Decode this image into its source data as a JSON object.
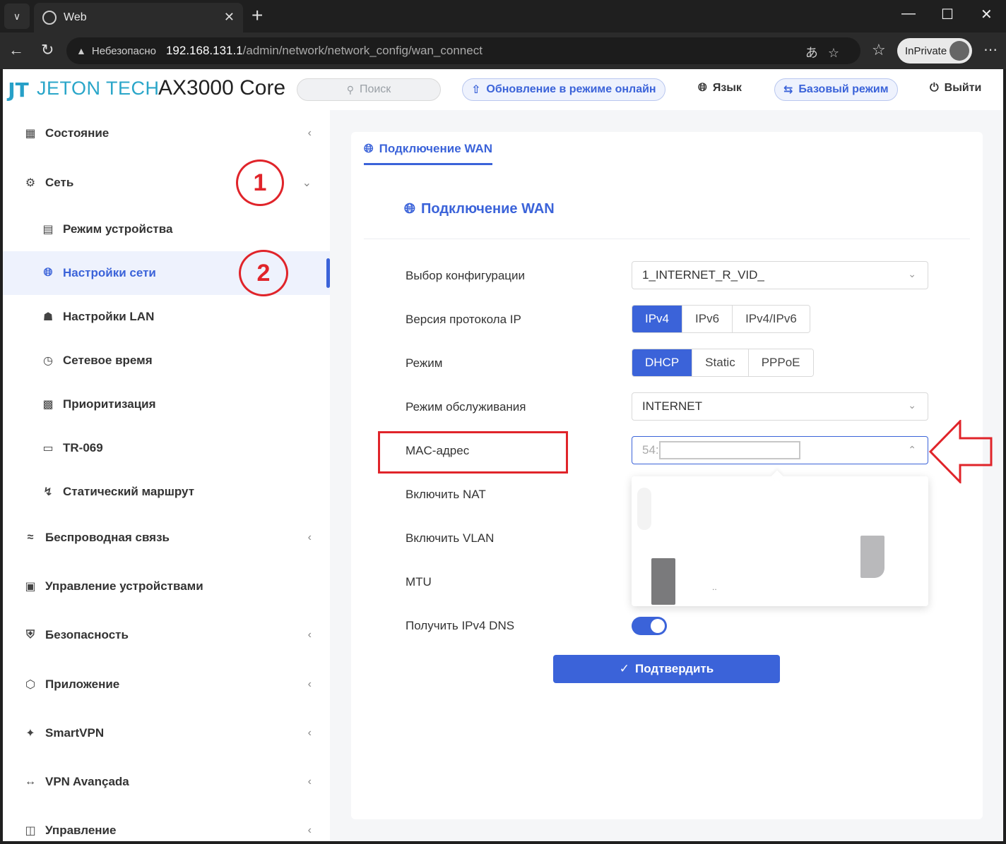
{
  "browser": {
    "tab_title": "Web",
    "security_label": "Небезопасно",
    "url_host": "192.168.131.1",
    "url_path": "/admin/network/network_config/wan_connect",
    "inprivate_label": "InPrivate"
  },
  "header": {
    "brand": "JETON TECH",
    "model": "AX3000 Core",
    "search_placeholder": "Поиск",
    "update_online": "Обновление в режиме онлайн",
    "language": "Язык",
    "basic_mode": "Базовый режим",
    "logout": "Выйти"
  },
  "sidebar": {
    "status": "Состояние",
    "network": "Сеть",
    "device_mode": "Режим устройства",
    "network_settings": "Настройки сети",
    "lan_settings": "Настройки LAN",
    "network_time": "Сетевое время",
    "prioritization": "Приоритизация",
    "tr069": "TR-069",
    "static_route": "Статический маршрут",
    "wireless": "Беспроводная связь",
    "device_management": "Управление устройствами",
    "security": "Безопасность",
    "application": "Приложение",
    "smartvpn": "SmartVPN",
    "vpn_advanced": "VPN Avançada",
    "management": "Управление"
  },
  "annotations": {
    "step1": "1",
    "step2": "2"
  },
  "main": {
    "tab_label": "Подключение WAN",
    "section_title": "Подключение WAN",
    "labels": {
      "config_select": "Выбор конфигурации",
      "ip_version": "Версия протокола IP",
      "mode": "Режим",
      "service_mode": "Режим обслуживания",
      "mac": "MAC-адрес",
      "nat": "Включить NAT",
      "vlan": "Включить VLAN",
      "mtu": "MTU",
      "ipv4_dns": "Получить IPv4 DNS"
    },
    "config_value": "1_INTERNET_R_VID_",
    "ip_versions": [
      "IPv4",
      "IPv6",
      "IPv4/IPv6"
    ],
    "modes": [
      "DHCP",
      "Static",
      "PPPoE"
    ],
    "service_value": "INTERNET",
    "mac_prefix": "54:",
    "dropdown_dots": "..",
    "ipv4_dns_enabled": true,
    "confirm_label": "Подтвердить"
  },
  "colors": {
    "accent": "#3b63d9",
    "annotation_red": "#e0242a",
    "brand_teal": "#2aa6c9"
  }
}
